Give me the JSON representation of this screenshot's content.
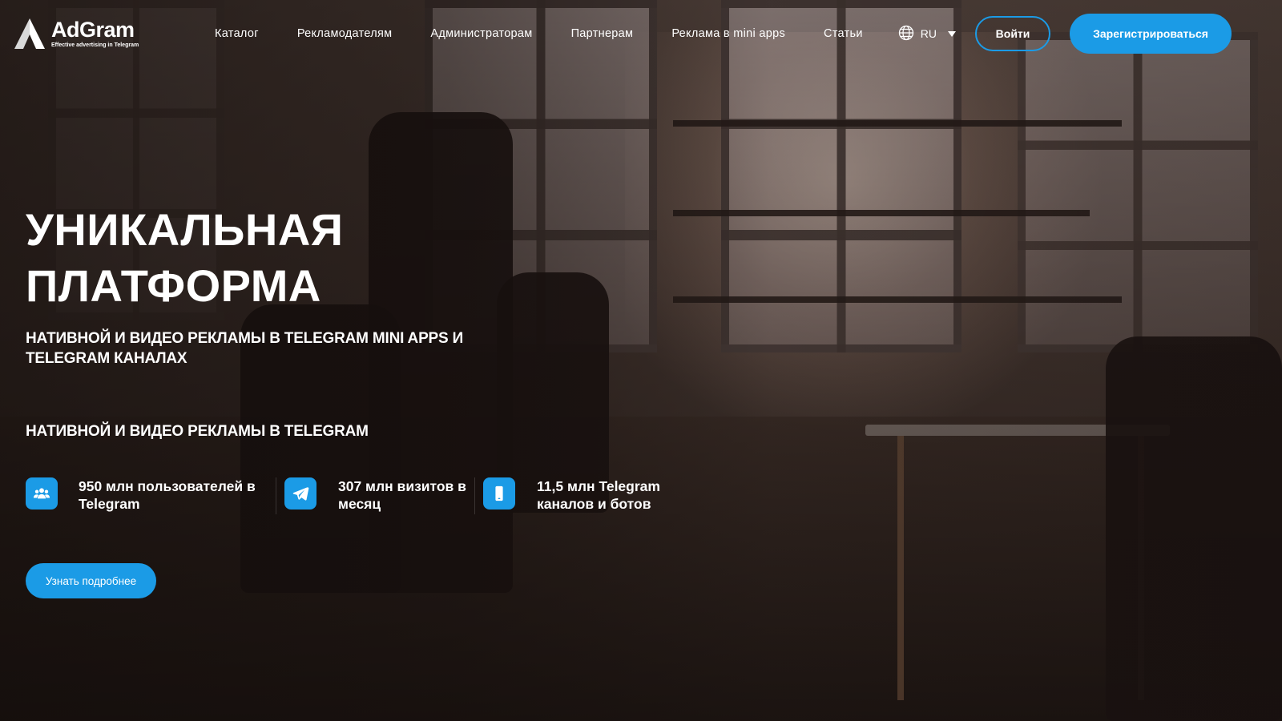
{
  "brand": {
    "name": "AdGram",
    "tagline": "Effective advertising in Telegram",
    "accent_color": "#1b9be6"
  },
  "nav": {
    "items": [
      {
        "label": "Каталог"
      },
      {
        "label": "Рекламодателям"
      },
      {
        "label": "Администраторам"
      },
      {
        "label": "Партнерам"
      },
      {
        "label": "Реклама в mini apps"
      },
      {
        "label": "Статьи"
      }
    ],
    "language": {
      "icon": "globe-icon",
      "value": "RU"
    },
    "login_label": "Войти",
    "register_label": "Зарегистрироваться"
  },
  "hero": {
    "title_line1": "УНИКАЛЬНАЯ",
    "title_line2": "ПЛАТФОРМА",
    "subtitle": "НАТИВНОЙ И ВИДЕО РЕКЛАМЫ В TELEGRAM MINI APPS И TELEGRAM КАНАЛАХ",
    "subtitle2": "НАТИВНОЙ И ВИДЕО РЕКЛАМЫ В TELEGRAM",
    "stats": [
      {
        "icon": "users-icon",
        "text": "950 млн пользователей в Telegram"
      },
      {
        "icon": "telegram-icon",
        "text": "307 млн визитов в месяц"
      },
      {
        "icon": "phone-icon",
        "text": "11,5 млн Telegram каналов и ботов"
      }
    ],
    "cta_label": "Узнать подробнее"
  }
}
